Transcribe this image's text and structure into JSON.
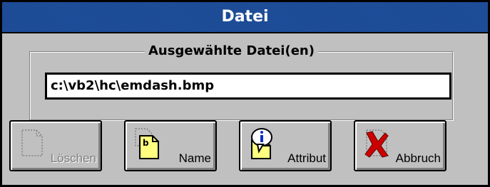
{
  "window": {
    "title": "Datei"
  },
  "group": {
    "legend": "Ausgewählte Datei(en)",
    "file_value": "c:\\vb2\\hc\\emdash.bmp"
  },
  "buttons": {
    "delete_label": "Löschen",
    "name_label": "Name",
    "attribute_label": "Attribut",
    "cancel_label": "Abbruch"
  },
  "icons": {
    "delete": "blank-document-icon",
    "name": "rename-document-icon",
    "attribute": "info-document-icon",
    "cancel": "red-x-icon"
  },
  "colors": {
    "titlebar": "#1e4f9c",
    "face": "#c0c0c0",
    "cancel_x": "#cc0000",
    "info_blue": "#1030c0",
    "document_yellow": "#ffff80"
  }
}
